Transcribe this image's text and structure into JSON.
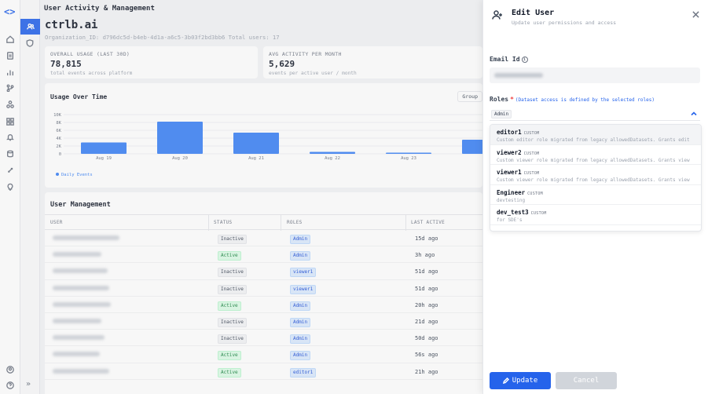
{
  "header": {
    "title": "User Activity & Management"
  },
  "org": {
    "name": "ctrlb.ai",
    "meta": "Organization_ID: d796dc5d-b4eb-4d1a-a6c5-3b03f2bd3bb6  Total users: 17"
  },
  "stats": [
    {
      "label": "OVERALL USAGE (LAST 30D)",
      "value": "78,815",
      "sub": "total events across platform"
    },
    {
      "label": "AVG ACTIVITY PER MONTH",
      "value": "5,629",
      "sub": "events per active user / month"
    }
  ],
  "chart": {
    "title": "Usage Over Time",
    "group_button": "Group",
    "legend": "Daily Events",
    "color": "#3b82f6"
  },
  "chart_data": {
    "type": "bar",
    "title": "Usage Over Time",
    "categories": [
      "Aug 19",
      "Aug 20",
      "Aug 21",
      "Aug 22",
      "Aug 23",
      ""
    ],
    "series": [
      {
        "name": "Daily Events",
        "values": [
          2900,
          8200,
          5400,
          500,
          300,
          3600
        ]
      }
    ],
    "yticks": [
      "0",
      "2K",
      "4K",
      "6K",
      "8K",
      "10K"
    ],
    "ylim": [
      0,
      10000
    ],
    "grid": true,
    "legend_position": "bottom-left"
  },
  "user_mgmt": {
    "title": "User Management",
    "columns": [
      "USER",
      "STATUS",
      "ROLES",
      "LAST ACTIVE"
    ],
    "rows": [
      {
        "status": "Inactive",
        "role": "Admin",
        "last": "15d ago"
      },
      {
        "status": "Active",
        "role": "Admin",
        "last": "3h ago"
      },
      {
        "status": "Inactive",
        "role": "viewer1",
        "last": "51d ago"
      },
      {
        "status": "Inactive",
        "role": "viewer1",
        "last": "51d ago"
      },
      {
        "status": "Active",
        "role": "Admin",
        "last": "20h ago"
      },
      {
        "status": "Inactive",
        "role": "Admin",
        "last": "21d ago"
      },
      {
        "status": "Inactive",
        "role": "Admin",
        "last": "50d ago"
      },
      {
        "status": "Active",
        "role": "Admin",
        "last": "56s ago"
      },
      {
        "status": "Active",
        "role": "editor1",
        "last": "21h ago"
      }
    ]
  },
  "panel": {
    "title": "Edit User",
    "subtitle": "Update user permissions and access",
    "email_label": "Email Id",
    "roles_label": "Roles",
    "roles_required": "*",
    "roles_hint": "(Dataset access is defined by the selected roles)",
    "selected_role": "Admin",
    "options": [
      {
        "name": "editor1",
        "tag": "CUSTOM",
        "desc": "Custom editor role migrated from legacy allowedDatasets. Grants edit"
      },
      {
        "name": "viewer2",
        "tag": "CUSTOM",
        "desc": "Custom viewer role migrated from legacy allowedDatasets. Grants view"
      },
      {
        "name": "viewer1",
        "tag": "CUSTOM",
        "desc": "Custom viewer role migrated from legacy allowedDatasets. Grants view"
      },
      {
        "name": "Engineer",
        "tag": "CUSTOM",
        "desc": "devtesting"
      },
      {
        "name": "dev_test3",
        "tag": "CUSTOM",
        "desc": "for SDE's"
      }
    ],
    "update_label": "Update",
    "cancel_label": "Cancel"
  }
}
